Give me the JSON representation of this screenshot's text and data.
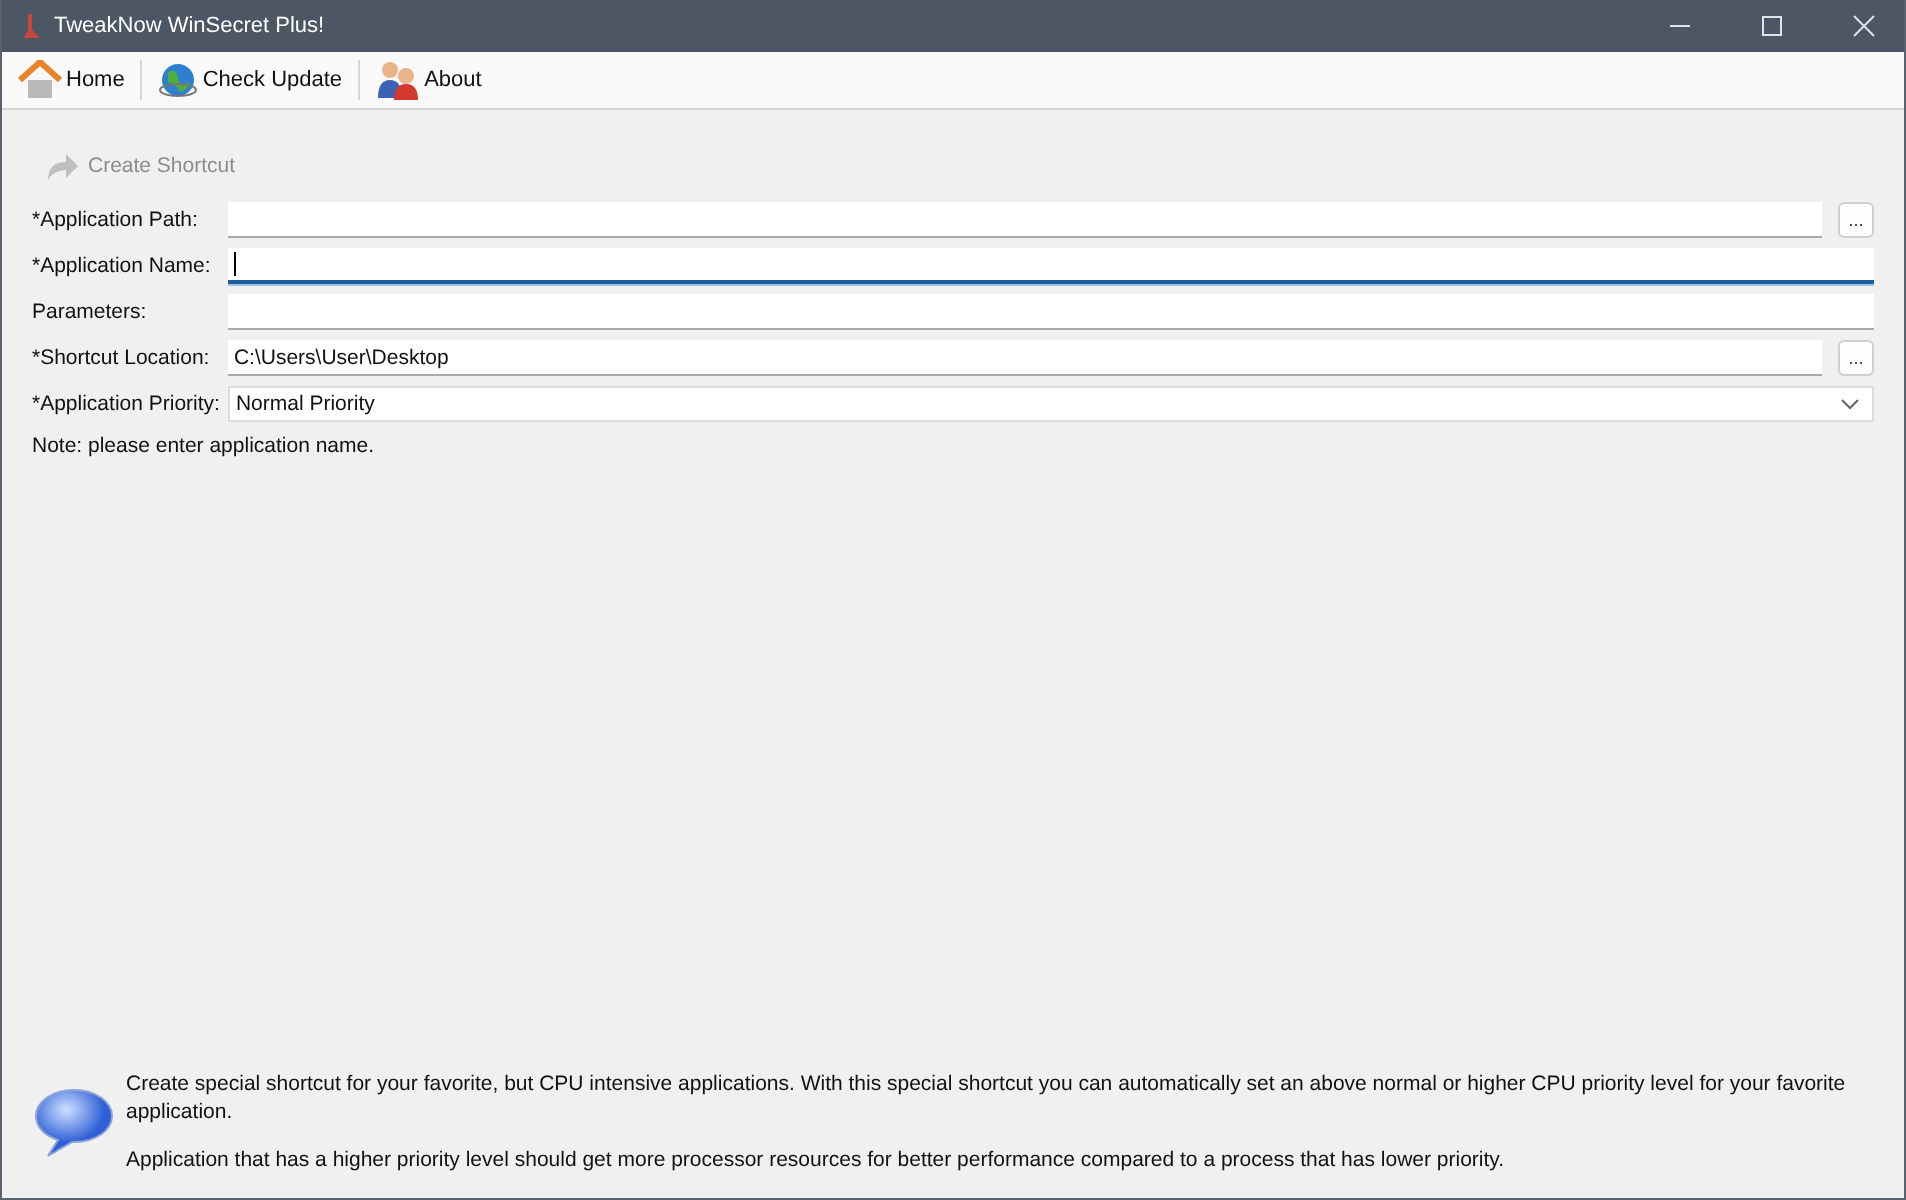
{
  "window": {
    "title": "TweakNow WinSecret Plus!"
  },
  "toolbar": [
    {
      "label": "Home",
      "kind": "home"
    },
    {
      "label": "Check Update",
      "kind": "globe"
    },
    {
      "label": "About",
      "kind": "people"
    }
  ],
  "action": {
    "label": "Create Shortcut",
    "disabled": true
  },
  "fields": [
    {
      "label": "*Application Path:",
      "kind": "browse",
      "focused": false,
      "button": "..."
    },
    {
      "label": "*Application Name:",
      "kind": "text",
      "focused": true
    },
    {
      "label": "Parameters:",
      "kind": "text",
      "focused": false
    },
    {
      "label": "*Shortcut Location:",
      "value": "C:\\Users\\User\\Desktop",
      "kind": "browse",
      "focused": false,
      "button": "..."
    },
    {
      "label": "*Application Priority:",
      "value": "Normal Priority",
      "kind": "dropdown",
      "focused": false
    }
  ],
  "note": "Note: please enter application name.",
  "info": [
    "Create special shortcut for your favorite, but CPU intensive applications. With this special shortcut you can automatically set an above normal or higher CPU priority level for your favorite application.",
    "Application that has a higher priority level should get more processor resources for better performance compared to a process that has lower priority."
  ]
}
